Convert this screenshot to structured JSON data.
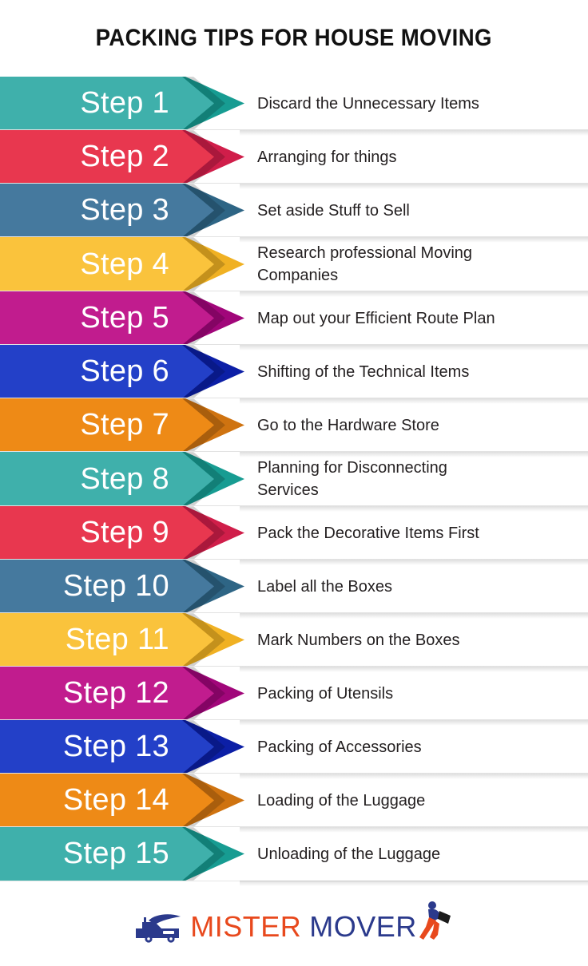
{
  "header": {
    "title": "PACKING TIPS FOR HOUSE MOVING"
  },
  "palette": {
    "teal_light": "#3FB0AB",
    "teal_dark": "#179C92",
    "red_light": "#E8374F",
    "red_dark": "#D01E4A",
    "steel_light": "#45799E",
    "steel_dark": "#2E6585",
    "yellow_light": "#FAC33C",
    "yellow_dark": "#F0B123",
    "magenta_light": "#C11C8E",
    "magenta_dark": "#A1067A",
    "blue_light": "#2340C8",
    "blue_dark": "#0C1FA6",
    "orange_light": "#EE8A16",
    "orange_dark": "#CF7310",
    "text_dark": "#231f20",
    "step_label_color": "#ffffff",
    "background": "#ffffff",
    "logo_orange": "#E8491D",
    "logo_navy": "#2B3A8C"
  },
  "steps": [
    {
      "label": "Step 1",
      "text": "Discard the Unnecessary Items",
      "light": "#3FB0AB",
      "dark": "#179C92"
    },
    {
      "label": "Step 2",
      "text": "Arranging for things",
      "light": "#E8374F",
      "dark": "#D01E4A"
    },
    {
      "label": "Step 3",
      "text": "Set aside Stuff to Sell",
      "light": "#45799E",
      "dark": "#2E6585"
    },
    {
      "label": "Step 4",
      "text": "Research professional Moving Companies",
      "light": "#FAC33C",
      "dark": "#F0B123"
    },
    {
      "label": "Step 5",
      "text": "Map out your Efficient Route Plan",
      "light": "#C11C8E",
      "dark": "#A1067A"
    },
    {
      "label": "Step 6",
      "text": "Shifting of the Technical Items",
      "light": "#2340C8",
      "dark": "#0C1FA6"
    },
    {
      "label": "Step 7",
      "text": "Go to the Hardware Store",
      "light": "#EE8A16",
      "dark": "#CF7310"
    },
    {
      "label": "Step 8",
      "text": "Planning for Disconnecting Services",
      "light": "#3FB0AB",
      "dark": "#179C92"
    },
    {
      "label": "Step 9",
      "text": "Pack the Decorative Items First",
      "light": "#E8374F",
      "dark": "#D01E4A"
    },
    {
      "label": "Step 10",
      "text": "Label all the Boxes",
      "light": "#45799E",
      "dark": "#2E6585"
    },
    {
      "label": "Step 11",
      "text": "Mark Numbers on the Boxes",
      "light": "#FAC33C",
      "dark": "#F0B123"
    },
    {
      "label": "Step 12",
      "text": "Packing of Utensils",
      "light": "#C11C8E",
      "dark": "#A1067A"
    },
    {
      "label": "Step 13",
      "text": "Packing of Accessories",
      "light": "#2340C8",
      "dark": "#0C1FA6"
    },
    {
      "label": "Step 14",
      "text": "Loading of the Luggage",
      "light": "#EE8A16",
      "dark": "#CF7310"
    },
    {
      "label": "Step 15",
      "text": "Unloading of the Luggage",
      "light": "#3FB0AB",
      "dark": "#179C92"
    }
  ],
  "footer": {
    "logo": {
      "word_1": "MISTER",
      "word_2": "MOVER",
      "truck_icon": "moving-truck-icon",
      "mover_icon": "person-carrying-box-icon"
    }
  }
}
